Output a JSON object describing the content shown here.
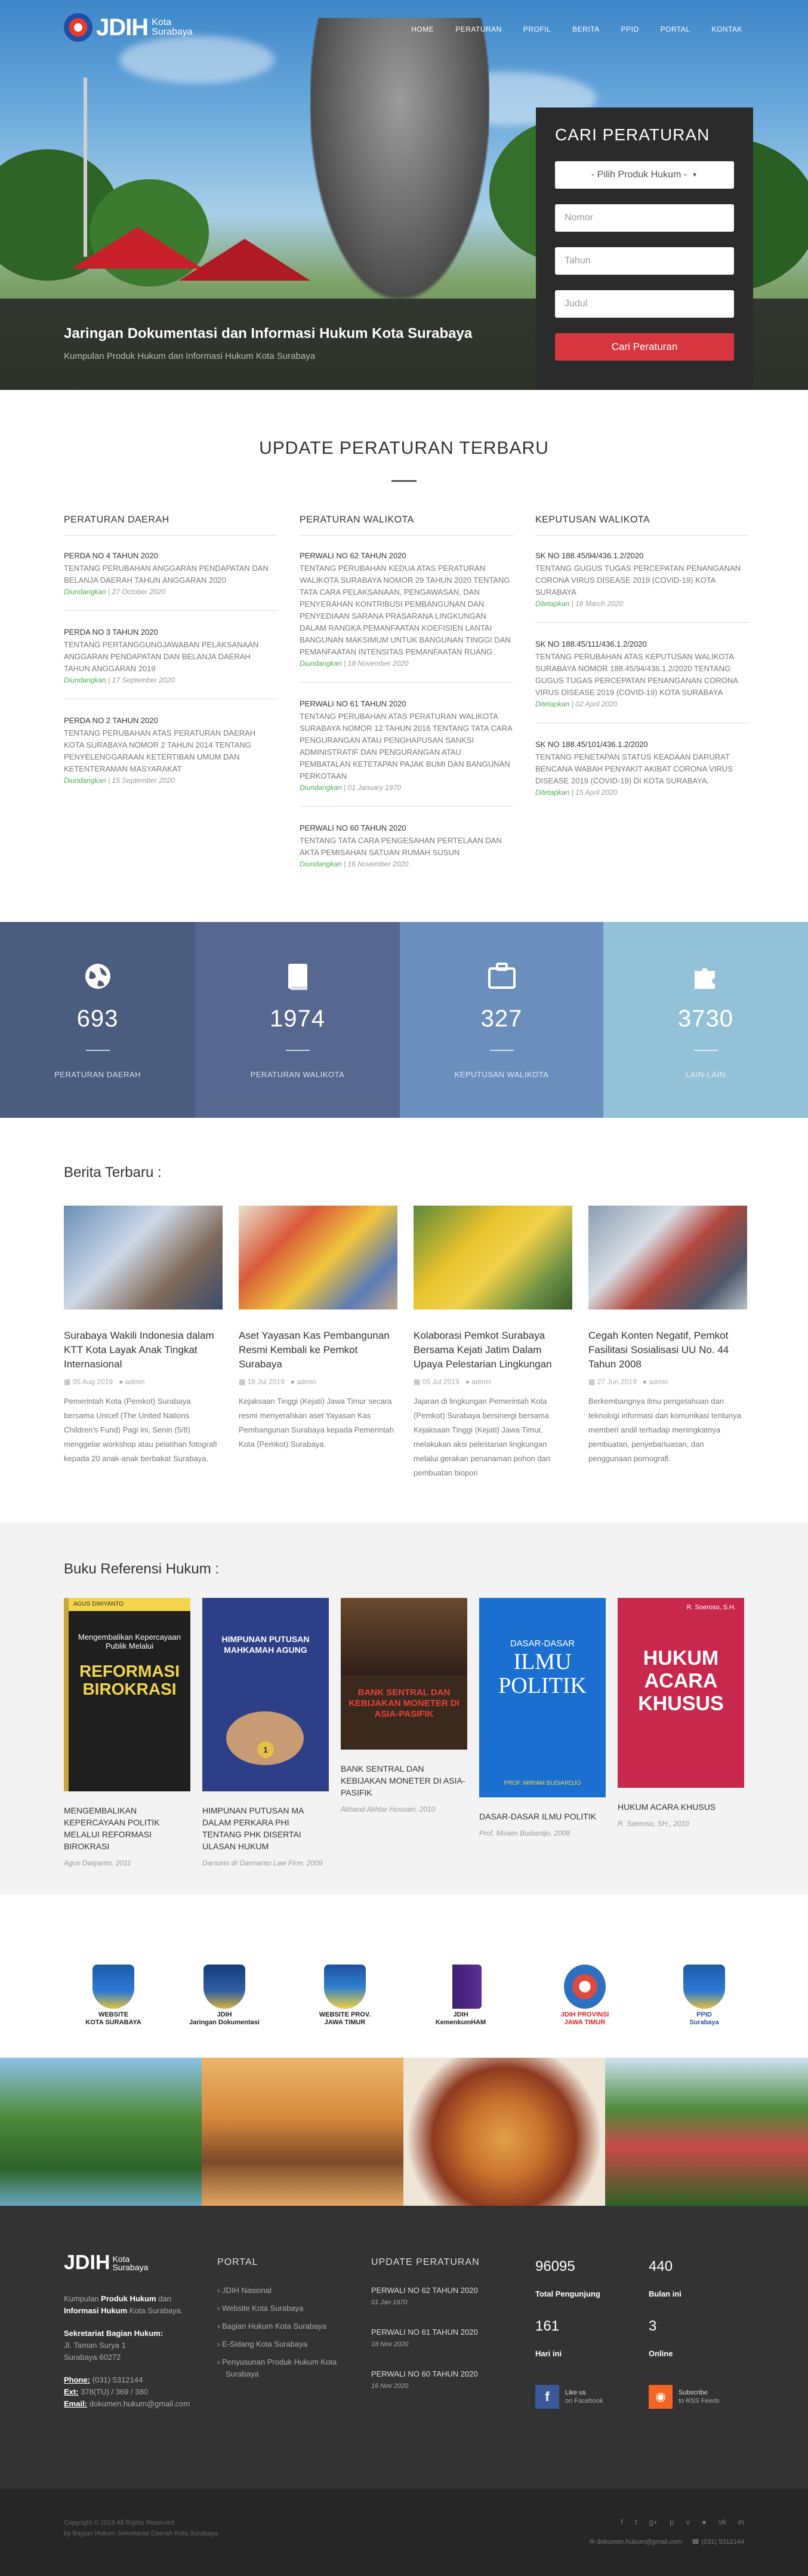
{
  "brand": {
    "name": "JDIH",
    "city_line1": "Kota",
    "city_line2": "Surabaya"
  },
  "nav": [
    "HOME",
    "PERATURAN",
    "PROFIL",
    "BERITA",
    "PPID",
    "PORTAL",
    "KONTAK"
  ],
  "hero": {
    "title": "Jaringan Dokumentasi dan Informasi Hukum Kota Surabaya",
    "subtitle": "Kumpulan Produk Hukum dan Informasi Hukum Kota Surabaya"
  },
  "search": {
    "title": "CARI PERATURAN",
    "select_value": "- Pilih Produk Hukum -",
    "nomor_placeholder": "Nomor",
    "tahun_placeholder": "Tahun",
    "judul_placeholder": "Judul",
    "button": "Cari Peraturan"
  },
  "update": {
    "title": "UPDATE PERATURAN TERBARU",
    "columns": [
      {
        "heading": "PERATURAN DAERAH",
        "items": [
          {
            "title": "PERDA NO 4 TAHUN 2020",
            "desc": "TENTANG PERUBAHAN ANGGARAN PENDAPATAN DAN BELANJA DAERAH TAHUN ANGGARAN 2020",
            "status": "Diundangkan",
            "date": "27 October 2020"
          },
          {
            "title": "PERDA NO 3 TAHUN 2020",
            "desc": "TENTANG PERTANGGUNGJAWABAN PELAKSANAAN ANGGARAN PENDAPATAN DAN BELANJA DAERAH TAHUN ANGGARAN 2019",
            "status": "Diundangkan",
            "date": "17 September 2020"
          },
          {
            "title": "PERDA NO 2 TAHUN 2020",
            "desc": "TENTANG PERUBAHAN ATAS PERATURAN DAERAH KOTA SURABAYA NOMOR 2 TAHUN 2014 TENTANG PENYELENGGARAAN KETERTIBAN UMUM DAN KETENTERAMAN MASYARAKAT",
            "status": "Diundangkan",
            "date": "15 September 2020"
          }
        ]
      },
      {
        "heading": "PERATURAN WALIKOTA",
        "items": [
          {
            "title": "PERWALI NO 62 TAHUN 2020",
            "desc": "TENTANG PERUBAHAN KEDUA ATAS PERATURAN WALIKOTA SURABAYA NOMOR 29 TAHUN 2020 TENTANG TATA CARA PELAKSANAAN, PENGAWASAN, DAN PENYERAHAN KONTRIBUSI PEMBANGUNAN DAN PENYEDIAAN SARANA PRASARANA LINGKUNGAN DALAM RANGKA PEMANFAATAN KOEFISIEN LANTAI BANGUNAN MAKSIMUM UNTUK BANGUNAN TINGGI DAN PEMANFAATAN INTENSITAS PEMANFAATAN RUANG",
            "status": "Diundangkan",
            "date": "18 November 2020"
          },
          {
            "title": "PERWALI NO 61 TAHUN 2020",
            "desc": "TENTANG PERUBAHAN ATAS PERATURAN WALIKOTA SURABAYA NOMOR 12 TAHUN 2016 TENTANG TATA CARA PENGURANGAN ATAU PENGHAPUSAN SANKSI ADMINISTRATIF DAN PENGURANGAN ATAU PEMBATALAN KETETAPAN PAJAK BUMI DAN BANGUNAN PERKOTAAN",
            "status": "Diundangkan",
            "date": "01 January 1970"
          },
          {
            "title": "PERWALI NO 60 TAHUN 2020",
            "desc": "TENTANG TATA CARA PENGESAHAN PERTELAAN DAN AKTA PEMISAHAN SATUAN RUMAH SUSUN",
            "status": "Diundangkan",
            "date": "16 November 2020"
          }
        ]
      },
      {
        "heading": "KEPUTUSAN WALIKOTA",
        "items": [
          {
            "title": "SK NO 188.45/94/436.1.2/2020",
            "desc": "TENTANG GUGUS TUGAS PERCEPATAN PENANGANAN CORONA VIRUS DISEASE 2019 (COVID-19) KOTA SURABAYA",
            "status": "Ditetapkan",
            "date": "16 March 2020"
          },
          {
            "title": "SK NO 188.45/111/436.1.2/2020",
            "desc": "TENTANG PERUBAHAN ATAS KEPUTUSAN WALIKOTA SURABAYA NOMOR 188.45/94/436.1.2/2020 TENTANG GUGUS TUGAS PERCEPATAN PENANGANAN CORONA VIRUS DISEASE 2019 (COVID-19) KOTA SURABAYA",
            "status": "Ditetapkan",
            "date": "02 April 2020"
          },
          {
            "title": "SK NO 188.45/101/436.1.2/2020",
            "desc": "TENTANG PENETAPAN STATUS KEADAAN DARURAT BENCANA WABAH PENYAKIT AKIBAT CORONA VIRUS DISEASE 2019 (COVID-19) DI KOTA SURABAYA.",
            "status": "Ditetapkan",
            "date": "15 April 2020"
          }
        ]
      }
    ]
  },
  "stats": [
    {
      "icon": "globe-icon",
      "glyph": "🌐",
      "value": "693",
      "label": "PERATURAN DAERAH",
      "bg": "#4a5d7f"
    },
    {
      "icon": "book-icon",
      "glyph": "📕",
      "value": "1974",
      "label": "PERATURAN WALIKOTA",
      "bg": "#56688f"
    },
    {
      "icon": "briefcase-icon",
      "glyph": "💼",
      "value": "327",
      "label": "KEPUTUSAN WALIKOTA",
      "bg": "#6b8fbd"
    },
    {
      "icon": "puzzle-icon",
      "glyph": "🧩",
      "value": "3730",
      "label": "LAIN-LAIN",
      "bg": "#93c1d8"
    }
  ],
  "berita": {
    "title": "Berita Terbaru :",
    "items": [
      {
        "title": "Surabaya Wakili Indonesia dalam KTT Kota Layak Anak Tingkat Internasional",
        "date": "05 Aug 2019",
        "author": "admin",
        "excerpt": "Pemerintah Kota (Pemkot) Surabaya bersama Unicef (The United Nations Children's Fund) Pagi ini, Senin (5/8) menggelar workshop atau pelatihan fotografi kepada 20 anak-anak berbakat Surabaya."
      },
      {
        "title": "Aset Yayasan Kas Pembangunan Resmi Kembali ke Pemkot Surabaya",
        "date": "16 Jul 2019",
        "author": "admin",
        "excerpt": "Kejaksaan Tinggi (Kejati) Jawa Timur secara resmi menyerahkan aset Yayasan Kas Pembangunan Surabaya kepada Pemerintah Kota (Pemkot) Surabaya."
      },
      {
        "title": "Kolaborasi Pemkot Surabaya Bersama Kejati Jatim Dalam Upaya Pelestarian Lingkungan",
        "date": "05 Jul 2019",
        "author": "admin",
        "excerpt": "Jajaran di lingkungan Pemerintah Kota (Pemkot) Surabaya bersinergi bersama Kejaksaan Tinggi (Kejati) Jawa Timur, melakukan aksi pelestarian lingkungan melalui gerakan penanaman pohon dan pembuatan biopori"
      },
      {
        "title": "Cegah Konten Negatif, Pemkot Fasilitasi Sosialisasi UU No. 44 Tahun 2008",
        "date": "27 Jun 2019",
        "author": "admin",
        "excerpt": "Berkembangnya ilmu pengetahuan dan teknologi informasi dan komunikasi tentunya memberi andil terhadap meningkatnya pembuatan, penyebarluasan, dan penggunaan pornografi."
      }
    ]
  },
  "buku": {
    "title": "Buku Referensi Hukum :",
    "items": [
      {
        "title": "MENGEMBALIKAN KEPERCAYAAN POLITIK MELALUI REFORMASI BIROKRASI",
        "author": "Agus Dwiyanto, 2011",
        "cover_top": "AGUS DWIYANTO",
        "cover_main": "REFORMASI BIROKRASI",
        "cover_sub": "Mengembalikan Kepercayaan Publik Melalui"
      },
      {
        "title": "HIMPUNAN PUTUSAN MA DALAM PERKARA PHI TENTANG PHK DISERTAI ULASAN HUKUM",
        "author": "Darsono dr Darmanto Law Firm, 2009",
        "cover_main": "HIMPUNAN PUTUSAN MAHKAMAH AGUNG",
        "cover_sub": "1"
      },
      {
        "title": "BANK SENTRAL DAN KEBIJAKAN MONETER DI ASIA-PASIFIK",
        "author": "Akhand Akhtar Hossain, 2010",
        "cover_main": "BANK SENTRAL DAN KEBIJAKAN MONETER DI ASIA-PASIFIK"
      },
      {
        "title": "DASAR-DASAR ILMU POLITIK",
        "author": "Prof. Miriam Budiardjo, 2008",
        "cover_top": "DASAR-DASAR",
        "cover_main": "ILMU POLITIK",
        "cover_sub": "PROF. MIRIAM BUDIARDJO"
      },
      {
        "title": "HUKUM ACARA KHUSUS",
        "author": "R. Soeroso, SH., 2010",
        "cover_top": "R. Soeroso, S.H.",
        "cover_main": "HUKUM ACARA KHUSUS"
      }
    ]
  },
  "links": [
    {
      "icon": "surabaya-emblem-icon",
      "label1": "WEBSITE",
      "label2": "KOTA SURABAYA"
    },
    {
      "icon": "jdih-nasional-icon",
      "label1": "JDIH",
      "label2": "Jaringan Dokumentasi"
    },
    {
      "icon": "jatim-emblem-icon",
      "label1": "WEBSITE PROV.",
      "label2": "JAWA TIMUR"
    },
    {
      "icon": "kemenkumham-icon",
      "label1": "JDIH",
      "label2": "KemenkumHAM"
    },
    {
      "icon": "jdih-jatim-icon",
      "label1": "JDIH PROVINSI",
      "label2": "JAWA TIMUR"
    },
    {
      "icon": "ppid-icon",
      "label1": "PPID",
      "label2": "Surabaya"
    }
  ],
  "footer": {
    "about_pre": "Kumpulan ",
    "about_b1": "Produk Hukum",
    "about_mid": " dan ",
    "about_b2": "Informasi Hukum",
    "about_post": " Kota Surabaya.",
    "addr_head": "Sekretariat Bagian Hukum:",
    "addr1": "Jl. Taman Surya 1",
    "addr2": "Surabaya 60272",
    "phone_label": "Phone:",
    "phone": "(031) 5312144",
    "ext_label": "Ext:",
    "ext": "378(TU) / 369 / 380",
    "email_label": "Email:",
    "email": "dokumen.hukum@gmail.com",
    "portal_title": "PORTAL",
    "portal": [
      "JDIH Nasional",
      "Website Kota Surabaya",
      "Bagian Hukum Kota Surabaya",
      "E-Sidang Kota Surabaya",
      "Penyusunan Produk Hukum Kota Surabaya"
    ],
    "upd_title": "UPDATE PERATURAN",
    "updates": [
      {
        "title": "PERWALI NO 62 TAHUN 2020",
        "date": "01 Jan 1970"
      },
      {
        "title": "PERWALI NO 61 TAHUN 2020",
        "date": "18 Nov 2020"
      },
      {
        "title": "PERWALI NO 60 TAHUN 2020",
        "date": "16 Nov 2020"
      }
    ],
    "counters": [
      {
        "value": "96095",
        "label": "Total Pengunjung"
      },
      {
        "value": "440",
        "label": "Bulan ini"
      },
      {
        "value": "161",
        "label": "Hari ini"
      },
      {
        "value": "3",
        "label": "Online"
      }
    ],
    "like": {
      "title": "Like us",
      "sub": "on Facebook"
    },
    "subscribe": {
      "title": "Subscribe",
      "sub": "to RSS Feeds"
    },
    "copyright1": "Copyright © 2018 All Rights Reserved",
    "copyright2": "by Bagian Hukum Sekretariat Daerah Kota Surabaya",
    "contact_email": "dokumen.hukum@gmail.com",
    "contact_phone": "(031) 5312144"
  },
  "colors": {
    "accent_red": "#d8363f",
    "green": "#4caf50",
    "dark": "#333333"
  }
}
